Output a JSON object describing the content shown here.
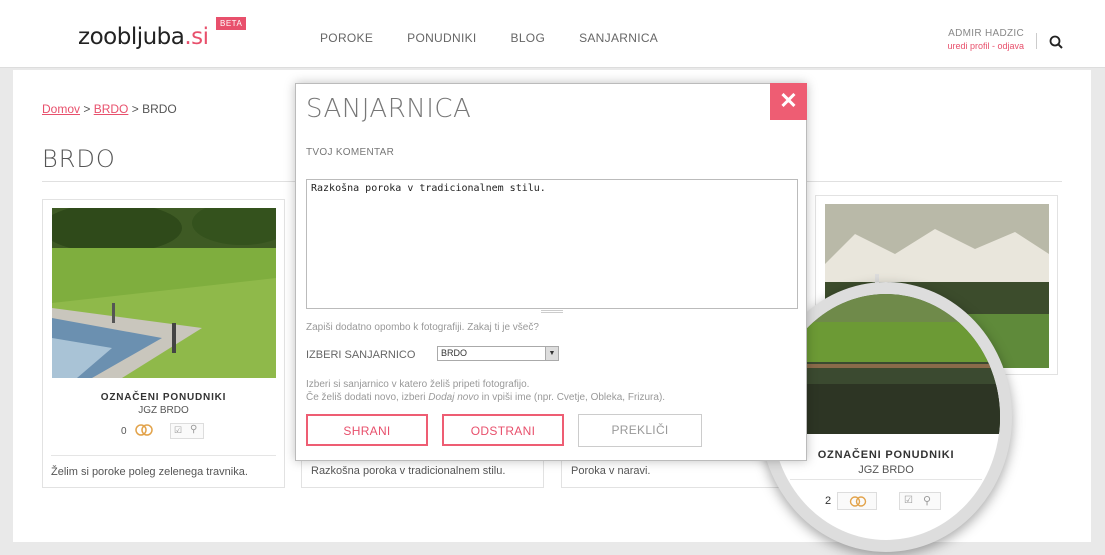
{
  "header": {
    "logo_main": "zoobljuba",
    "logo_tld": ".si",
    "beta": "BETA",
    "nav": [
      "POROKE",
      "PONUDNIKI",
      "BLOG",
      "SANJARNICA"
    ],
    "user_name": "ADMIR HADZIC",
    "user_links": "uredi profil - odjava",
    "search_icon": "search-icon"
  },
  "breadcrumb": {
    "home": "Domov",
    "sep1": " > ",
    "mid": "BRDO",
    "sep2": " > ",
    "current": "BRDO"
  },
  "page_title": "BRDO",
  "cards": [
    {
      "title": "OZNAČENI PONUDNIKI",
      "subtitle": "JGZ BRDO",
      "count": "0",
      "comment": "Želim si poroke poleg zelenega travnika."
    },
    {
      "comment": "Razkošna poroka v tradicionalnem stilu."
    },
    {
      "comment": "Poroka v naravi."
    }
  ],
  "magnifier": {
    "title": "OZNAČENI PONUDNIKI",
    "subtitle": "JGZ BRDO",
    "count": "2"
  },
  "modal": {
    "title": "SANJARNICA",
    "close": "✕",
    "comment_label": "TVOJ KOMENTAR",
    "comment_value": "Razkošna poroka v tradicionalnem stilu.",
    "hint": "Zapiši dodatno opombo k fotografiji. Zakaj ti je všeč?",
    "select_label": "IZBERI SANJARNICO",
    "select_value": "BRDO",
    "info_line1": "Izberi si sanjarnico v katero želiš pripeti fotografijo.",
    "info_line2_a": "Če želiš dodati novo, izberi ",
    "info_line2_em": "Dodaj novo",
    "info_line2_b": " in vpiši ime (npr. Cvetje, Obleka, Frizura).",
    "save": "SHRANI",
    "remove": "ODSTRANI",
    "cancel": "PREKLIČI"
  }
}
